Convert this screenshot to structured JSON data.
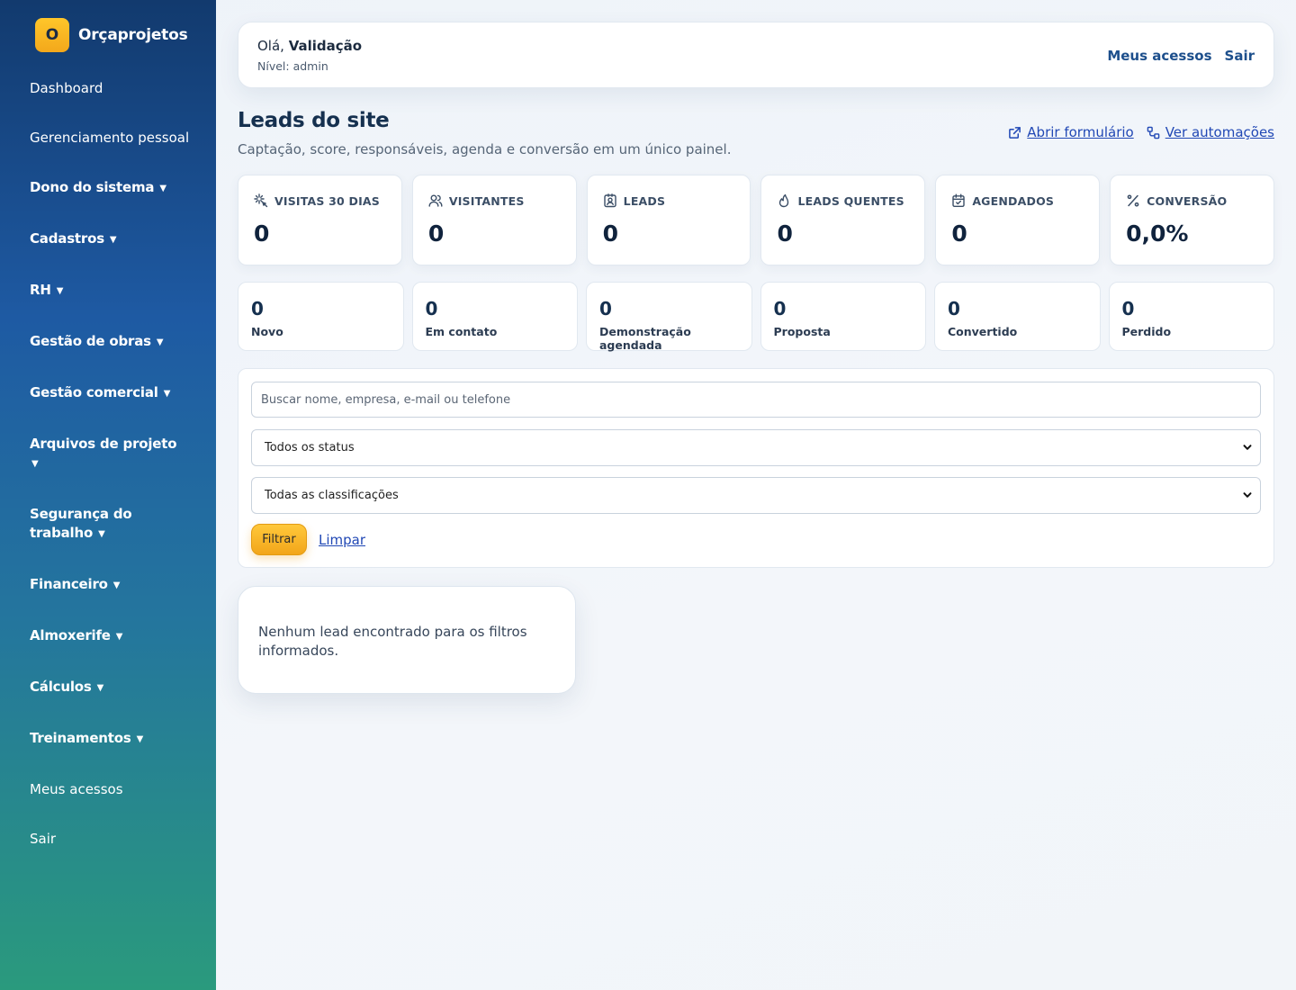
{
  "brand": {
    "logo_letter": "O",
    "name": "Orçaprojetos"
  },
  "sidebar": {
    "items": [
      {
        "label": "Dashboard"
      },
      {
        "label": "Gerenciamento pessoal"
      },
      {
        "label": "Dono do sistema"
      },
      {
        "label": "Cadastros"
      },
      {
        "label": "RH"
      },
      {
        "label": "Gestão de obras"
      },
      {
        "label": "Gestão comercial"
      },
      {
        "label": "Arquivos de projeto"
      },
      {
        "label": "Segurança do trabalho"
      },
      {
        "label": "Financeiro"
      },
      {
        "label": "Almoxerife"
      },
      {
        "label": "Cálculos"
      },
      {
        "label": "Treinamentos"
      },
      {
        "label": "Meus acessos"
      },
      {
        "label": "Sair"
      }
    ],
    "caret": "▼"
  },
  "topbar": {
    "greeting": "Olá,",
    "user_name": "Validação",
    "level": "Nível: admin",
    "my_access": "Meus acessos",
    "logout": "Sair"
  },
  "page": {
    "title": "Leads do site",
    "subtitle": "Captação, score, responsáveis, agenda e conversão em um único painel.",
    "open_form": "Abrir formulário",
    "see_automations": "Ver automações"
  },
  "stats": [
    {
      "label": "VISITAS 30 DIAS",
      "value": "0",
      "icon": "sparkle-icon"
    },
    {
      "label": "VISITANTES",
      "value": "0",
      "icon": "users-icon"
    },
    {
      "label": "LEADS",
      "value": "0",
      "icon": "contact-badge-icon"
    },
    {
      "label": "LEADS QUENTES",
      "value": "0",
      "icon": "flame-icon"
    },
    {
      "label": "AGENDADOS",
      "value": "0",
      "icon": "calendar-check-icon"
    },
    {
      "label": "CONVERSÃO",
      "value": "0,0%",
      "icon": "percent-icon"
    }
  ],
  "statuses": [
    {
      "value": "0",
      "label": "Novo"
    },
    {
      "value": "0",
      "label": "Em contato"
    },
    {
      "value": "0",
      "label": "Demonstração agendada"
    },
    {
      "value": "0",
      "label": "Proposta"
    },
    {
      "value": "0",
      "label": "Convertido"
    },
    {
      "value": "0",
      "label": "Perdido"
    }
  ],
  "filters": {
    "search_placeholder": "Buscar nome, empresa, e-mail ou telefone",
    "status_selected": "Todos os status",
    "classification_selected": "Todas as classificações",
    "filter_button": "Filtrar",
    "clear_link": "Limpar"
  },
  "empty_state": "Nenhum lead encontrado para os filtros informados.",
  "colors": {
    "sidebar_top": "#123a6e",
    "sidebar_bottom": "#2a9a7d",
    "accent": "#f5b021",
    "link": "#2148b5",
    "title": "#15304f"
  }
}
